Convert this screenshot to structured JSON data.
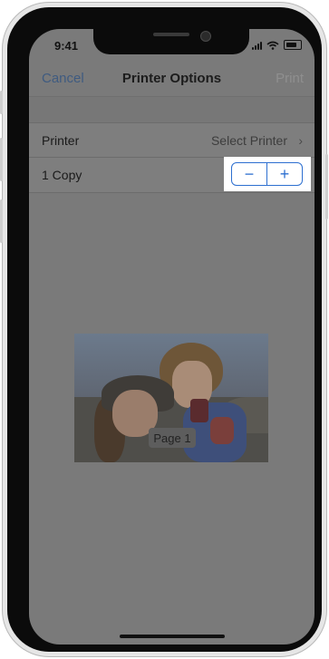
{
  "status_bar": {
    "time": "9:41"
  },
  "navbar": {
    "cancel": "Cancel",
    "title": "Printer Options",
    "print": "Print"
  },
  "options": {
    "printer_label": "Printer",
    "printer_value": "Select Printer",
    "copies_label": "1 Copy"
  },
  "stepper": {
    "minus": "−",
    "plus": "+"
  },
  "preview": {
    "page_label": "Page 1"
  },
  "colors": {
    "accent": "#2d6fd0",
    "dim_overlay": "#7a7a7a",
    "cancel": "#3f5b80"
  }
}
